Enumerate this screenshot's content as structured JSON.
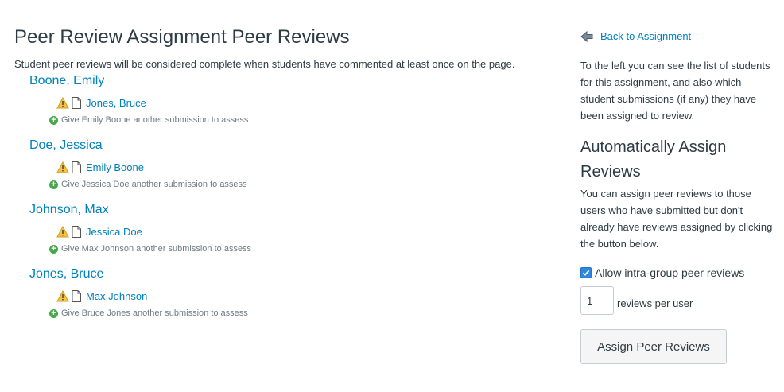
{
  "page": {
    "title": "Peer Review Assignment Peer Reviews",
    "intro": "Student peer reviews will be considered complete when students have commented at least once on the page."
  },
  "students": [
    {
      "name": "Boone, Emily",
      "assessor": "Jones, Bruce",
      "give_text": "Give Emily Boone another submission to assess"
    },
    {
      "name": "Doe, Jessica",
      "assessor": "Emily Boone",
      "give_text": "Give Jessica Doe another submission to assess"
    },
    {
      "name": "Johnson, Max",
      "assessor": "Jessica Doe",
      "give_text": "Give Max Johnson another submission to assess"
    },
    {
      "name": "Jones, Bruce",
      "assessor": "Max Johnson",
      "give_text": "Give Bruce Jones another submission to assess"
    }
  ],
  "sidebar": {
    "back_label": "Back to Assignment",
    "description": "To the left you can see the list of students for this assignment, and also which student submissions (if any) they have been assigned to review.",
    "auto_heading": "Automatically Assign Reviews",
    "auto_description": "You can assign peer reviews to those users who have submitted but don't already have reviews assigned by clicking the button below.",
    "intra_group_label": "Allow intra-group peer reviews",
    "intra_group_checked": true,
    "reviews_count": "1",
    "reviews_per_user_label": "reviews per user",
    "assign_button": "Assign Peer Reviews"
  },
  "icons": {
    "warning": "warning-icon",
    "document": "document-icon",
    "add": "plus-circle-icon",
    "back": "arrow-left-icon",
    "check": "check-icon"
  },
  "colors": {
    "link": "#0081bd",
    "text": "#2d3b45",
    "muted": "#6f7b84",
    "add_green": "#48a84e",
    "checkbox_blue": "#2e86de",
    "warning_yellow": "#f5c343"
  }
}
